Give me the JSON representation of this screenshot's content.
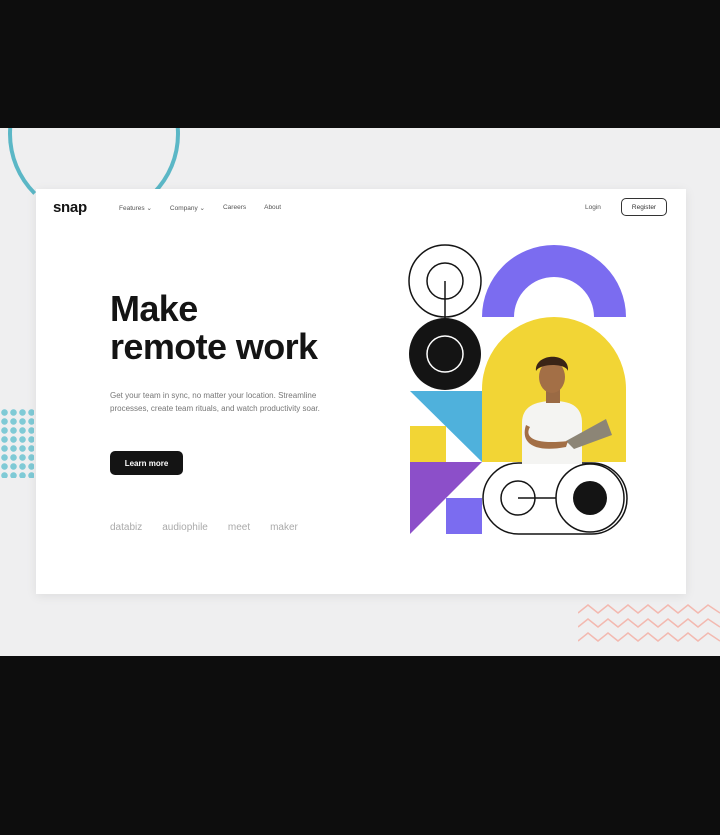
{
  "nav": {
    "logo": "snap",
    "items": [
      "Features ⌄",
      "Company ⌄",
      "Careers",
      "About"
    ],
    "login": "Login",
    "register": "Register"
  },
  "hero": {
    "title_line1": "Make",
    "title_line2": "remote work",
    "subtitle": "Get your team in sync, no matter your location. Streamline processes, create team rituals, and watch productivity soar.",
    "cta": "Learn more"
  },
  "clients": [
    "databiz",
    "audiophile",
    "meet",
    "maker"
  ],
  "colors": {
    "background": "#efeff0",
    "card": "#ffffff",
    "text": "#141414",
    "accent_purple": "#7b6cf0",
    "accent_yellow": "#f2d535",
    "accent_blue": "#4fb1dc",
    "accent_violet": "#8c4fc9",
    "accent_teal": "#5bb7c6"
  }
}
